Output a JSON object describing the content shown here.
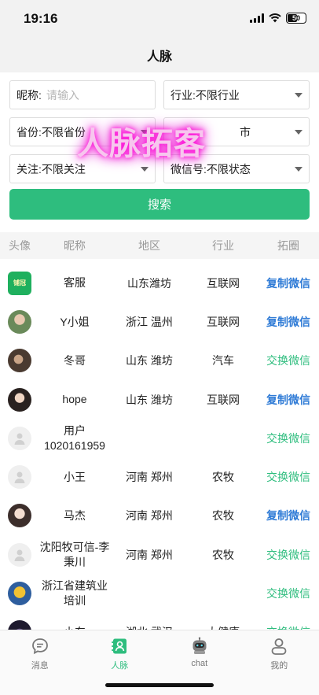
{
  "status": {
    "time": "19:16",
    "battery": "50"
  },
  "nav": {
    "title": "人脉"
  },
  "filters": {
    "nickname": {
      "label": "昵称:",
      "placeholder": "请输入"
    },
    "industry": {
      "label": "行业:",
      "value": "不限行业"
    },
    "province": {
      "label": "省份:",
      "value": "不限省份"
    },
    "city": {
      "value": "市"
    },
    "follow": {
      "label": "关注:",
      "value": "不限关注"
    },
    "wechat": {
      "label": "微信号:",
      "value": "不限状态"
    }
  },
  "search_button": "搜索",
  "watermark": "人脉拓客",
  "table": {
    "headers": [
      "头像",
      "昵称",
      "地区",
      "行业",
      "拓圈"
    ],
    "rows": [
      {
        "name": "客服",
        "region": "山东潍坊",
        "industry": "互联网",
        "action": "复制微信",
        "action_type": "copy",
        "avatar": "logo"
      },
      {
        "name": "Y小姐",
        "region": "浙江 温州",
        "industry": "互联网",
        "action": "复制微信",
        "action_type": "copy",
        "avatar": "photo-green"
      },
      {
        "name": "冬哥",
        "region": "山东 潍坊",
        "industry": "汽车",
        "action": "交换微信",
        "action_type": "swap",
        "avatar": "photo-brown"
      },
      {
        "name": "hope",
        "region": "山东 潍坊",
        "industry": "互联网",
        "action": "复制微信",
        "action_type": "copy",
        "avatar": "photo-dark"
      },
      {
        "name": "用户1020161959",
        "region": "",
        "industry": "",
        "action": "交换微信",
        "action_type": "swap",
        "avatar": "default"
      },
      {
        "name": "小王",
        "region": "河南 郑州",
        "industry": "农牧",
        "action": "交换微信",
        "action_type": "swap",
        "avatar": "default"
      },
      {
        "name": "马杰",
        "region": "河南 郑州",
        "industry": "农牧",
        "action": "复制微信",
        "action_type": "copy",
        "avatar": "photo-girl"
      },
      {
        "name": "沈阳牧可信-李秉川",
        "region": "河南 郑州",
        "industry": "农牧",
        "action": "交换微信",
        "action_type": "swap",
        "avatar": "default"
      },
      {
        "name": "浙江省建筑业培训",
        "region": "",
        "industry": "",
        "action": "交换微信",
        "action_type": "swap",
        "avatar": "photo-buddha"
      },
      {
        "name": "小东",
        "region": "湖北 武汉",
        "industry": "大健康",
        "action": "交换微信",
        "action_type": "swap",
        "avatar": "photo-night"
      }
    ]
  },
  "logo_text": "铺冠",
  "tabs": [
    {
      "label": "消息",
      "icon": "chat-bubble-icon"
    },
    {
      "label": "人脉",
      "icon": "contacts-icon"
    },
    {
      "label": "chat",
      "icon": "robot-icon"
    },
    {
      "label": "我的",
      "icon": "profile-icon"
    }
  ],
  "colors": {
    "accent": "#2ebd7e",
    "copy": "#2f7bd6",
    "watermark": "#ff1ad9"
  }
}
